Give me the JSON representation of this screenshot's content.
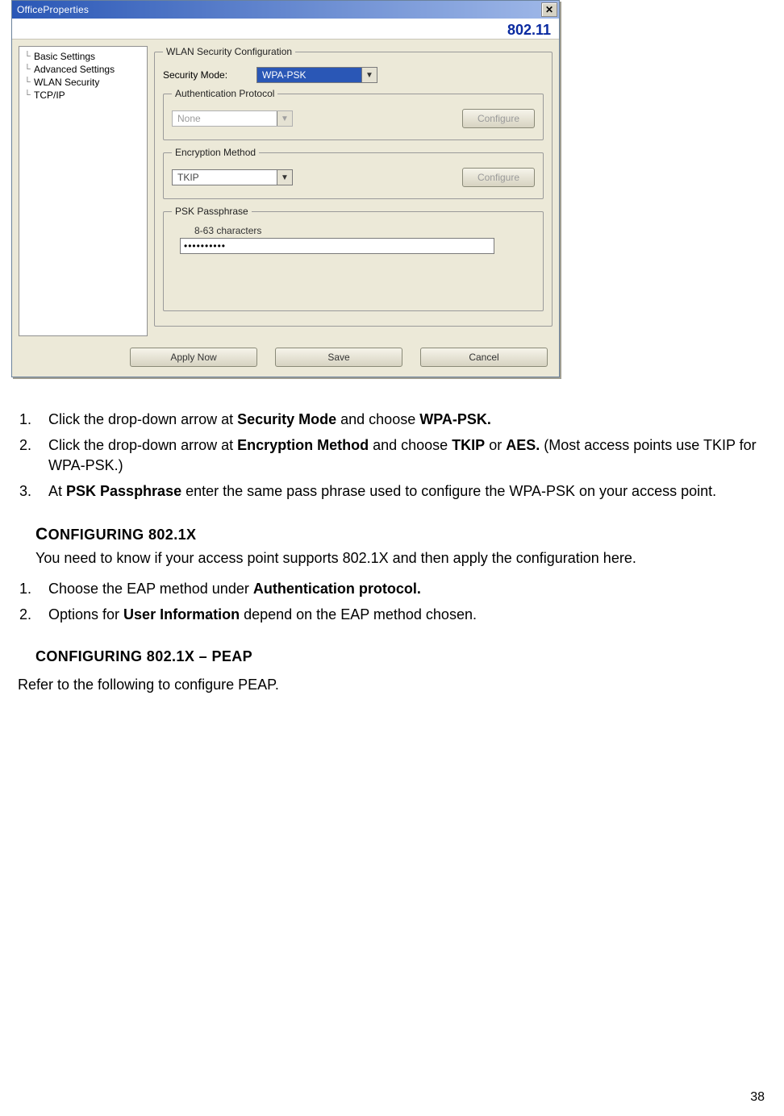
{
  "dialog": {
    "title": "OfficeProperties",
    "protocol": "802.11",
    "close_glyph": "✕",
    "sidebar_items": [
      "Basic Settings",
      "Advanced Settings",
      "WLAN Security",
      "TCP/IP"
    ],
    "wlan_group": {
      "legend": "WLAN Security Configuration",
      "security_mode_label": "Security Mode:",
      "security_mode_value": "WPA-PSK",
      "auth_group": {
        "legend": "Authentication Protocol",
        "value": "None",
        "configure": "Configure"
      },
      "enc_group": {
        "legend": "Encryption Method",
        "value": "TKIP",
        "configure": "Configure"
      },
      "psk_group": {
        "legend": "PSK Passphrase",
        "hint": "8-63 characters",
        "value": "••••••••••"
      }
    },
    "buttons": {
      "apply": "Apply Now",
      "save": "Save",
      "cancel": "Cancel"
    },
    "arrow_glyph": "▼"
  },
  "step1": {
    "pre": "Click the drop-down arrow at ",
    "b1": "Security Mode",
    "mid": " and choose ",
    "b2": "WPA-PSK."
  },
  "step2": {
    "pre": "Click the drop-down arrow at ",
    "b1": "Encryption Method",
    "mid": " and choose ",
    "b2": "TKIP",
    "or": " or ",
    "b3": "AES.",
    "tail": " (Most access points use TKIP for WPA-PSK.)"
  },
  "step3": {
    "pre": "At ",
    "b1": "PSK Passphrase",
    "tail": " enter the same pass phrase used to configure the WPA-PSK on your access point."
  },
  "section2": {
    "heading_prefix": "C",
    "heading_rest": "ONFIGURING 802.1X",
    "intro": "You need to know if your access point supports 802.1X and then apply the configuration here.",
    "step1_pre": "Choose the EAP method under ",
    "step1_b": "Authentication protocol.",
    "step2_pre": "Options for ",
    "step2_b": "User Information",
    "step2_tail": " depend on the EAP method chosen."
  },
  "section3": {
    "heading": "CONFIGURING 802.1X – PEAP",
    "text": "Refer to the following to configure PEAP."
  },
  "page_number": "38"
}
